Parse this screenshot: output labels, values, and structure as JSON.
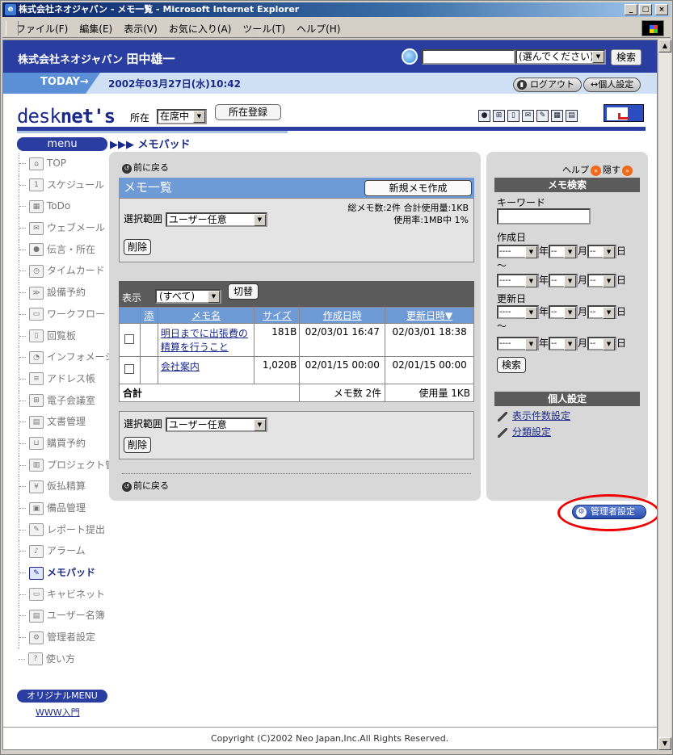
{
  "window": {
    "title": "株式会社ネオジャパン - メモ一覧 - Microsoft Internet Explorer",
    "controls": {
      "minimize": "_",
      "maximize": "□",
      "close": "×"
    }
  },
  "menubar": [
    "ファイル(F)",
    "編集(E)",
    "表示(V)",
    "お気に入り(A)",
    "ツール(T)",
    "ヘルプ(H)"
  ],
  "header": {
    "company": "株式会社ネオジャパン",
    "user": "田中雄一",
    "search_scope": "(選んでください)",
    "search_button": "検索"
  },
  "todaybar": {
    "label": "TODAY→",
    "datetime": "2002年03月27日(水)10:42",
    "logout": "ログアウト",
    "personal_settings": "↔個人設定"
  },
  "brand": {
    "logo_a": "desk",
    "logo_b": "net's",
    "status_label": "所在",
    "status_value": "在席中",
    "status_register": "所在登録"
  },
  "toolbar_icons": [
    "person-icon",
    "org-icon",
    "phone-icon",
    "webmail-icon",
    "memo-icon",
    "calendar-icon",
    "book-icon"
  ],
  "menu_label": "menu",
  "page_title": "▶▶▶ メモパッド",
  "nav": [
    {
      "label": "TOP",
      "icon": "home-icon",
      "glyph": "⌂"
    },
    {
      "label": "スケジュール",
      "icon": "schedule-icon",
      "glyph": "1"
    },
    {
      "label": "ToDo",
      "icon": "todo-icon",
      "glyph": "▦"
    },
    {
      "label": "ウェブメール",
      "icon": "webmail-icon",
      "glyph": "✉"
    },
    {
      "label": "伝言・所在",
      "icon": "message-icon",
      "glyph": "●"
    },
    {
      "label": "タイムカード",
      "icon": "timecard-icon",
      "glyph": "◷"
    },
    {
      "label": "設備予約",
      "icon": "facility-icon",
      "glyph": "≫"
    },
    {
      "label": "ワークフロー",
      "icon": "workflow-icon",
      "glyph": "▭"
    },
    {
      "label": "回覧板",
      "icon": "circular-icon",
      "glyph": "▯"
    },
    {
      "label": "インフォメーション",
      "icon": "info-icon",
      "glyph": "◔"
    },
    {
      "label": "アドレス帳",
      "icon": "address-icon",
      "glyph": "≡"
    },
    {
      "label": "電子会議室",
      "icon": "conference-icon",
      "glyph": "⊞"
    },
    {
      "label": "文書管理",
      "icon": "document-icon",
      "glyph": "▤"
    },
    {
      "label": "購買予約",
      "icon": "cart-icon",
      "glyph": "⊔"
    },
    {
      "label": "プロジェクト管理",
      "icon": "project-icon",
      "glyph": "▥"
    },
    {
      "label": "仮払精算",
      "icon": "payment-icon",
      "glyph": "¥"
    },
    {
      "label": "備品管理",
      "icon": "equipment-icon",
      "glyph": "▣"
    },
    {
      "label": "レポート提出",
      "icon": "report-icon",
      "glyph": "✎"
    },
    {
      "label": "アラーム",
      "icon": "alarm-icon",
      "glyph": "♪"
    },
    {
      "label": "メモパッド",
      "icon": "memopad-icon",
      "glyph": "✎",
      "current": true
    },
    {
      "label": "キャビネット",
      "icon": "cabinet-icon",
      "glyph": "▭"
    },
    {
      "label": "ユーザー名簿",
      "icon": "userlist-icon",
      "glyph": "▤"
    },
    {
      "label": "管理者設定",
      "icon": "admin-icon",
      "glyph": "⚙"
    },
    {
      "label": "使い方",
      "icon": "help-icon",
      "glyph": "?"
    }
  ],
  "original_menu": "オリジナルMENU",
  "www_link": "WWW入門",
  "main": {
    "back": "前に戻る",
    "list_title": "メモ一覧",
    "new_memo": "新規メモ作成",
    "scope_label": "選択範囲",
    "scope_value": "ユーザー任意",
    "delete": "削除",
    "stats_line1": "総メモ数:2件 合計使用量:1KB",
    "stats_line2": "使用率:1MB中 1%",
    "display_label": "表示",
    "display_value": "(すべて)",
    "switch": "切替",
    "columns": [
      "添",
      "メモ名",
      "サイズ",
      "作成日時",
      "更新日時▼"
    ],
    "rows": [
      {
        "name": "明日までに出張費の精算を行うこと",
        "size": "181B",
        "created": "02/03/01 16:47",
        "updated": "02/03/01 18:38"
      },
      {
        "name": "会社案内",
        "size": "1,020B",
        "created": "02/01/15 00:00",
        "updated": "02/01/15 00:00"
      }
    ],
    "total_label": "合計",
    "total_count": "メモ数 2件",
    "total_usage": "使用量 1KB"
  },
  "side": {
    "help": "ヘルプ",
    "hide": "隠す",
    "search_title": "メモ検索",
    "keyword": "キーワード",
    "created": "作成日",
    "updated": "更新日",
    "tilde": "〜",
    "blank_year": "----",
    "blank_md": "--",
    "year": "年",
    "month": "月",
    "day": "日",
    "search": "検索",
    "personal_title": "個人設定",
    "link_count": "表示件数設定",
    "link_category": "分類設定"
  },
  "admin_button": "管理者設定",
  "footer": "Copyright (C)2002 Neo Japan,Inc.All Rights Reserved."
}
